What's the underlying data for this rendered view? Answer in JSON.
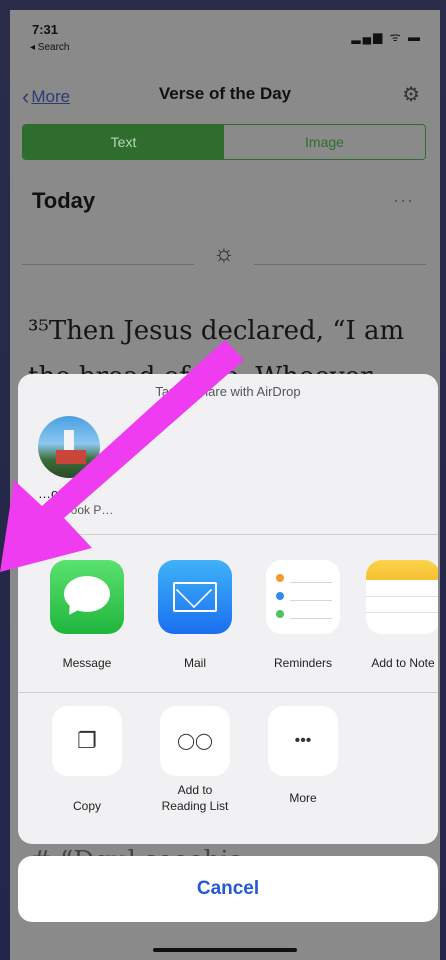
{
  "status_bar": {
    "time": "7:31",
    "back_app": "◂ Search",
    "signal_icons": "▂▄▆ ᯤ ▬"
  },
  "nav": {
    "back_label": "More",
    "title": "Verse of the Day"
  },
  "segment": {
    "text_tab": "Text",
    "image_tab": "Image"
  },
  "content": {
    "today_heading": "Today",
    "more_dots": "···",
    "verse_line1": "³⁵Then Jesus declared, “I am",
    "verse_line2": "the bread of life. Whoever",
    "verse_tail": "# “Dgul seeehis ahenlehugunke"
  },
  "share_sheet": {
    "airdrop_hint": "Tap to share with AirDrop",
    "airdrop_device": {
      "name": "…om",
      "subtitle": "…acBook P…"
    },
    "apps": [
      {
        "label": "Message",
        "icon": "messages-icon"
      },
      {
        "label": "Mail",
        "icon": "mail-icon"
      },
      {
        "label": "Reminders",
        "icon": "reminders-icon"
      },
      {
        "label": "Add to Note",
        "icon": "notes-icon"
      }
    ],
    "actions": [
      {
        "label": "Copy",
        "icon": "copy-icon",
        "glyph": "❐"
      },
      {
        "label": "Add to Reading List",
        "icon": "reading-list-icon",
        "glyph": "◯◯"
      },
      {
        "label": "More",
        "icon": "more-icon",
        "glyph": "•••"
      }
    ],
    "cancel_label": "Cancel"
  },
  "colors": {
    "accent_green": "#2e6d2e",
    "link_blue": "#2359d8",
    "annotation_arrow": "#f03cf0"
  }
}
